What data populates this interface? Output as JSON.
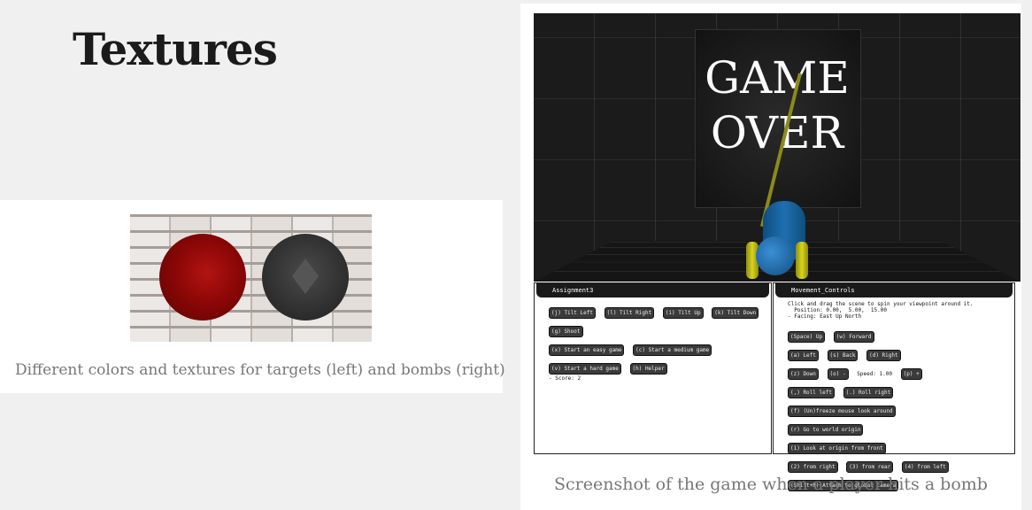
{
  "page": {
    "title": "Textures"
  },
  "left_figure": {
    "caption": "Different colors and textures for targets (left) and bombs (right)"
  },
  "right_figure": {
    "caption": "Screenshot of the game when a player hits a bomb",
    "scene_text_line1": "GAME",
    "scene_text_line2": "OVER"
  },
  "assignment_panel": {
    "header": "Assignment3",
    "rows": [
      [
        "(j) Tilt Left",
        "(l) Tilt Right",
        "(i) Tilt Up",
        "(k) Tilt Down",
        "(g) Shoot"
      ],
      [
        "(x) Start an easy game",
        "(c) Start a medium game"
      ],
      [
        "(v) Start a hard game",
        "(h) Helper"
      ]
    ],
    "score_text": "- Score: 2"
  },
  "movement_panel": {
    "header": "Movement_Controls",
    "intro": "Click and drag the scene to spin your viewpoint around it.",
    "position": "  Position: 0.00,  5.00,  15.00",
    "facing": "- Facing: East Up North",
    "row1": [
      "(Space) Up",
      "(w) Forward"
    ],
    "row2": [
      "(a) Left",
      "(s) Back",
      "(d) Right"
    ],
    "row3_key1": "(z) Down",
    "row3_key2": "(o) -",
    "row3_speed": "Speed: 1.00",
    "row3_key3": "(p) +",
    "row4": [
      "(,) Roll left",
      "(.) Roll right"
    ],
    "row5": [
      "(f) (Un)freeze mouse look around"
    ],
    "row6": [
      "(r) Go to world origin"
    ],
    "row7": [
      "(1) Look at origin from front"
    ],
    "row8": [
      "(2) from right",
      "(3) from rear",
      "(4) from left"
    ],
    "row9": [
      "(Shift+R) Attach to global camera"
    ]
  }
}
